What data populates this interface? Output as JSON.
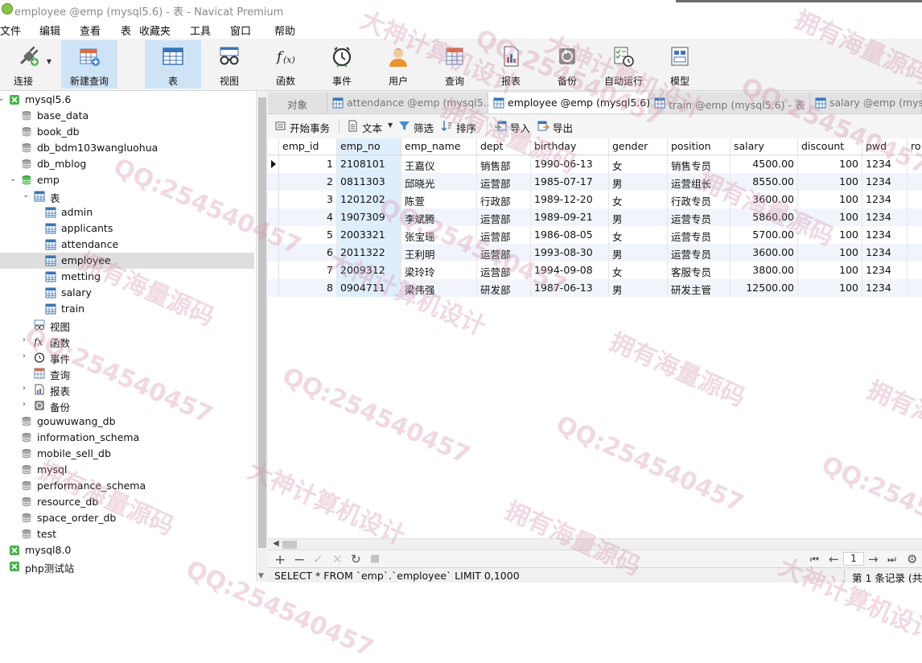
{
  "window": {
    "title": "employee @emp (mysql5.6) - 表 - Navicat Premium"
  },
  "menu": [
    "文件",
    "编辑",
    "查看",
    "表",
    "收藏夹",
    "工具",
    "窗口",
    "帮助"
  ],
  "toolbar": [
    {
      "label": "连接",
      "icon": "plug-icon"
    },
    {
      "label": "新建查询",
      "icon": "new-query-icon"
    },
    {
      "label": "表",
      "icon": "table-icon"
    },
    {
      "label": "视图",
      "icon": "view-glasses-icon"
    },
    {
      "label": "函数",
      "icon": "function-icon"
    },
    {
      "label": "事件",
      "icon": "alarm-clock-icon"
    },
    {
      "label": "用户",
      "icon": "user-icon"
    },
    {
      "label": "查询",
      "icon": "query-table-icon"
    },
    {
      "label": "报表",
      "icon": "report-icon"
    },
    {
      "label": "备份",
      "icon": "backup-icon"
    },
    {
      "label": "自动运行",
      "icon": "schedule-icon"
    },
    {
      "label": "模型",
      "icon": "model-icon"
    }
  ],
  "tree": [
    {
      "label": "mysql5.6",
      "icon": "server-icon",
      "expand": "down"
    },
    {
      "label": "base_data",
      "icon": "database-icon"
    },
    {
      "label": "book_db",
      "icon": "database-icon"
    },
    {
      "label": "db_bdm103wangluohua",
      "icon": "database-icon"
    },
    {
      "label": "db_mblog",
      "icon": "database-icon"
    },
    {
      "label": "emp",
      "icon": "database-open-icon",
      "expand": "down"
    },
    {
      "label": "表",
      "icon": "table-folder-icon",
      "expand": "down"
    },
    {
      "label": "admin",
      "icon": "table-icon"
    },
    {
      "label": "applicants",
      "icon": "table-icon"
    },
    {
      "label": "attendance",
      "icon": "table-icon"
    },
    {
      "label": "employee",
      "icon": "table-icon",
      "selected": true
    },
    {
      "label": "metting",
      "icon": "table-icon"
    },
    {
      "label": "salary",
      "icon": "table-icon"
    },
    {
      "label": "train",
      "icon": "table-icon"
    },
    {
      "label": "视图",
      "icon": "view-glasses-icon"
    },
    {
      "label": "函数",
      "icon": "function-icon",
      "expand": "right"
    },
    {
      "label": "事件",
      "icon": "alarm-clock-icon",
      "expand": "right"
    },
    {
      "label": "查询",
      "icon": "query-table-icon"
    },
    {
      "label": "报表",
      "icon": "report-icon",
      "expand": "right"
    },
    {
      "label": "备份",
      "icon": "backup-icon",
      "expand": "right"
    },
    {
      "label": "gouwuwang_db",
      "icon": "database-icon"
    },
    {
      "label": "information_schema",
      "icon": "database-icon"
    },
    {
      "label": "mobile_sell_db",
      "icon": "database-icon"
    },
    {
      "label": "mysql",
      "icon": "database-icon"
    },
    {
      "label": "performance_schema",
      "icon": "database-icon"
    },
    {
      "label": "resource_db",
      "icon": "database-icon"
    },
    {
      "label": "space_order_db",
      "icon": "database-icon"
    },
    {
      "label": "test",
      "icon": "database-icon"
    },
    {
      "label": "mysql8.0",
      "icon": "server-icon"
    },
    {
      "label": "php测试站",
      "icon": "server-icon"
    }
  ],
  "tabs": [
    {
      "label": "对象",
      "icon": "",
      "active": false
    },
    {
      "label": "attendance @emp (mysql5....",
      "icon": "table-icon",
      "active": false
    },
    {
      "label": "employee @emp (mysql5.6)...",
      "icon": "table-icon",
      "active": true
    },
    {
      "label": "train @emp (mysql5.6) - 表",
      "icon": "table-icon",
      "active": false
    },
    {
      "label": "salary @emp (mysq",
      "icon": "table-icon",
      "active": false
    }
  ],
  "subtoolbar": {
    "begin_transaction": "开始事务",
    "text": "文本",
    "filter": "筛选",
    "sort": "排序",
    "import": "导入",
    "export": "导出"
  },
  "table": {
    "columns": [
      "emp_id",
      "emp_no",
      "emp_name",
      "dept",
      "birthday",
      "gender",
      "position",
      "salary",
      "discount",
      "pwd",
      "ro"
    ],
    "rows": [
      [
        "1",
        "2108101",
        "王嘉仪",
        "销售部",
        "1990-06-13",
        "女",
        "销售专员",
        "4500.00",
        "100",
        "1234"
      ],
      [
        "2",
        "0811303",
        "邱晓光",
        "运营部",
        "1985-07-17",
        "男",
        "运营组长",
        "8550.00",
        "100",
        "1234"
      ],
      [
        "3",
        "1201202",
        "陈萱",
        "行政部",
        "1989-12-20",
        "女",
        "行政专员",
        "3600.00",
        "100",
        "1234"
      ],
      [
        "4",
        "1907309",
        "李斌腾",
        "运营部",
        "1989-09-21",
        "男",
        "运营专员",
        "5860.00",
        "100",
        "1234"
      ],
      [
        "5",
        "2003321",
        "张宝瑶",
        "运营部",
        "1986-08-05",
        "女",
        "运营专员",
        "5700.00",
        "100",
        "1234"
      ],
      [
        "6",
        "2011322",
        "王利明",
        "运营部",
        "1993-08-30",
        "男",
        "运营专员",
        "3600.00",
        "100",
        "1234"
      ],
      [
        "7",
        "2009312",
        "梁玲玲",
        "运营部",
        "1994-09-08",
        "女",
        "客服专员",
        "3800.00",
        "100",
        "1234"
      ],
      [
        "8",
        "0904711",
        "梁伟强",
        "研发部",
        "1987-06-13",
        "男",
        "研发主管",
        "12500.00",
        "100",
        "1234"
      ]
    ]
  },
  "pagination": {
    "page": "1"
  },
  "status": {
    "sql": "SELECT * FROM `emp`.`employee` LIMIT 0,1000",
    "records": "第 1 条记录 (共"
  },
  "watermarks": [
    "QQ:254540457",
    "拥有海量源码",
    "大神计算机设计"
  ]
}
